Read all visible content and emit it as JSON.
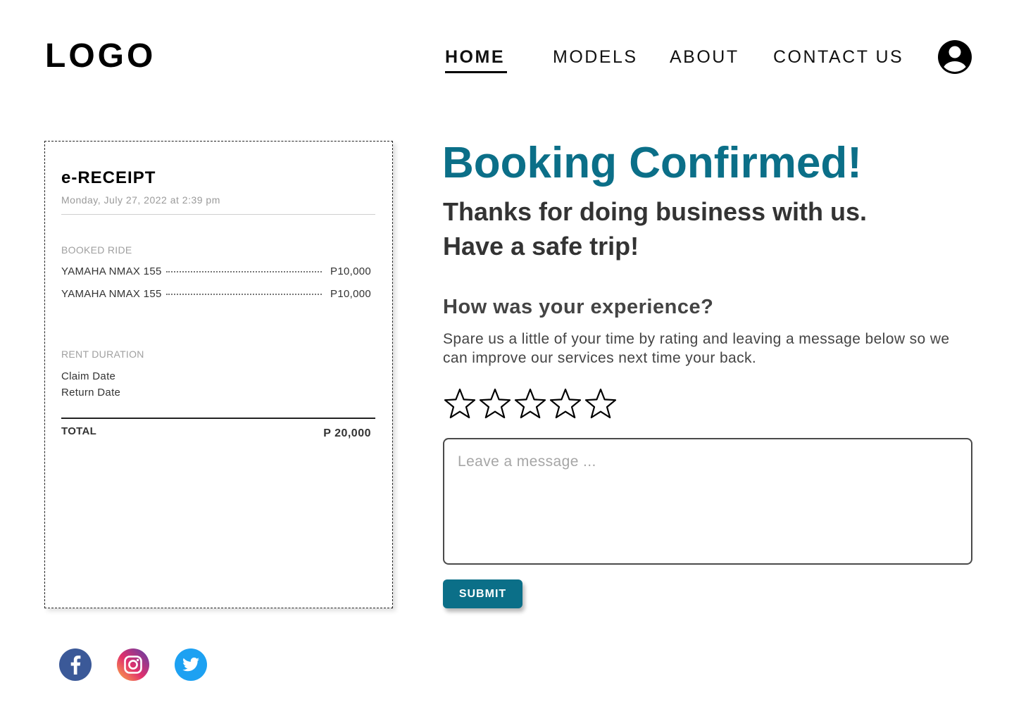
{
  "header": {
    "logo": "LOGO",
    "nav": [
      {
        "label": "HOME",
        "active": true
      },
      {
        "label": "MODELS",
        "active": false
      },
      {
        "label": "ABOUT",
        "active": false
      },
      {
        "label": "CONTACT US",
        "active": false
      }
    ],
    "profile_icon": "user-circle-icon"
  },
  "receipt": {
    "title": "e-RECEIPT",
    "date": "Monday, July 27, 2022 at 2:39 pm",
    "booked_ride_heading": "BOOKED RIDE",
    "items": [
      {
        "name": "YAMAHA NMAX 155",
        "price": "P10,000"
      },
      {
        "name": "YAMAHA NMAX 155",
        "price": "P10,000"
      }
    ],
    "rent_duration_heading": "RENT DURATION",
    "claim_date_label": "Claim Date",
    "return_date_label": "Return Date",
    "total_label": "TOTAL",
    "total_value": "P 20,000"
  },
  "confirmation": {
    "headline": "Booking Confirmed!",
    "thanks_line1": "Thanks for doing business with us.",
    "thanks_line2": "Have a safe trip!",
    "question": "How was your experience?",
    "description": "Spare us a little of your time by rating and leaving a message below so we can improve our services next time your back.",
    "rating": {
      "value": 0,
      "max": 5
    },
    "message_placeholder": "Leave a message ...",
    "submit_label": "SUBMIT"
  },
  "socials": [
    "facebook-icon",
    "instagram-icon",
    "twitter-icon"
  ],
  "colors": {
    "accent": "#0b6f88",
    "facebook": "#3b5998",
    "twitter": "#1da1f2"
  }
}
